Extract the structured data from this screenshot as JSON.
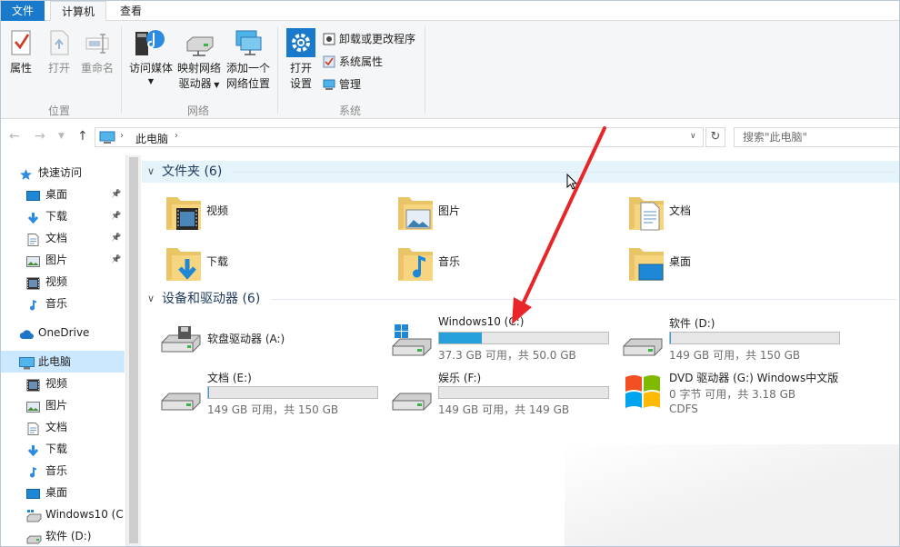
{
  "ribbon": {
    "tabs": [
      {
        "label": "文件"
      },
      {
        "label": "计算机"
      },
      {
        "label": "查看"
      }
    ],
    "groups": {
      "location": {
        "label": "位置",
        "buttons": [
          "属性",
          "打开",
          "重命名"
        ]
      },
      "network": {
        "label": "网络",
        "buttons": [
          "访问媒体",
          "映射网络",
          "驱动器",
          "添加一个",
          "网络位置"
        ]
      },
      "system": {
        "label": "系统",
        "open_settings": [
          "打开",
          "设置"
        ],
        "small": [
          "卸载或更改程序",
          "系统属性",
          "管理"
        ]
      }
    }
  },
  "address": {
    "crumb": "此电脑",
    "search_placeholder": "搜索\"此电脑\""
  },
  "nav": {
    "items": [
      {
        "label": "快速访问",
        "icon": "star-icon"
      },
      {
        "label": "桌面",
        "icon": "desktop-icon",
        "pinned": true
      },
      {
        "label": "下载",
        "icon": "download-icon",
        "pinned": true
      },
      {
        "label": "文档",
        "icon": "document-icon",
        "pinned": true
      },
      {
        "label": "图片",
        "icon": "picture-icon",
        "pinned": true
      },
      {
        "label": "视频",
        "icon": "video-icon"
      },
      {
        "label": "音乐",
        "icon": "music-icon"
      },
      {
        "label": "OneDrive",
        "icon": "cloud-icon"
      },
      {
        "label": "此电脑",
        "icon": "computer-icon",
        "selected": true
      },
      {
        "label": "视频",
        "icon": "video-icon"
      },
      {
        "label": "图片",
        "icon": "picture-icon"
      },
      {
        "label": "文档",
        "icon": "document-icon"
      },
      {
        "label": "下载",
        "icon": "download-icon"
      },
      {
        "label": "音乐",
        "icon": "music-icon"
      },
      {
        "label": "桌面",
        "icon": "desktop-icon"
      },
      {
        "label": "Windows10 (C:",
        "icon": "windows-drive-icon"
      },
      {
        "label": "软件 (D:)",
        "icon": "drive-icon"
      }
    ]
  },
  "content": {
    "folders_group": "文件夹 (6)",
    "folders": [
      {
        "label": "视频",
        "icon": "video-folder-icon"
      },
      {
        "label": "图片",
        "icon": "picture-folder-icon"
      },
      {
        "label": "文档",
        "icon": "document-folder-icon"
      },
      {
        "label": "下载",
        "icon": "download-folder-icon"
      },
      {
        "label": "音乐",
        "icon": "music-folder-icon"
      },
      {
        "label": "桌面",
        "icon": "desktop-folder-icon"
      }
    ],
    "devices_group": "设备和驱动器 (6)",
    "drives": [
      {
        "name": "软盘驱动器 (A:)",
        "free": "",
        "usage": null,
        "icon": "floppy-drive-icon"
      },
      {
        "name": "Windows10 (C:)",
        "free": "37.3 GB 可用，共 50.0 GB",
        "usage": 0.254,
        "icon": "windows-drive-icon"
      },
      {
        "name": "软件 (D:)",
        "free": "149 GB 可用，共 150 GB",
        "usage": 0.007,
        "icon": "drive-icon"
      },
      {
        "name": "文档 (E:)",
        "free": "149 GB 可用，共 150 GB",
        "usage": 0.007,
        "icon": "drive-icon"
      },
      {
        "name": "娱乐 (F:)",
        "free": "149 GB 可用，共 149 GB",
        "usage": 0.0,
        "icon": "drive-icon"
      },
      {
        "name": "DVD 驱动器 (G:) Windows中文版",
        "free": "0 字节 可用，共 3.18 GB",
        "extra": "CDFS",
        "usage": null,
        "icon": "dvd-drive-icon"
      }
    ]
  },
  "colors": {
    "accent": "#1979ca",
    "bar_fill": "#26a0da",
    "annotation": "#e8262a"
  }
}
